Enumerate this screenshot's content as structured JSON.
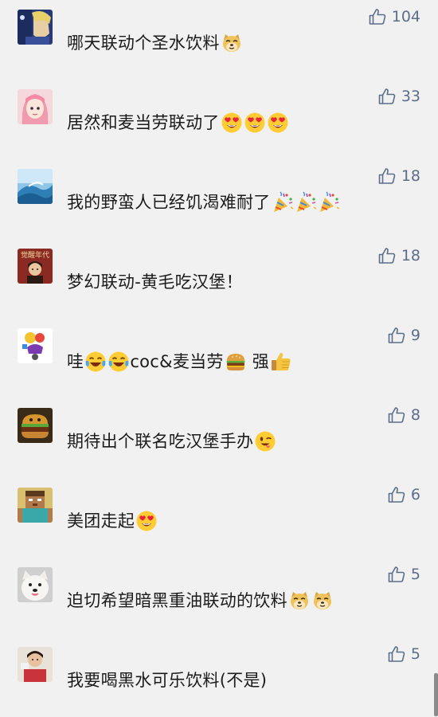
{
  "comments": [
    {
      "text": "哪天联动个圣水饮料",
      "likes": "104",
      "emojis": [
        "doge"
      ]
    },
    {
      "text": "居然和麦当劳联动了",
      "likes": "33",
      "emojis": [
        "heart-eyes",
        "heart-eyes",
        "heart-eyes"
      ]
    },
    {
      "text": "我的野蛮人已经饥渴难耐了",
      "likes": "18",
      "emojis": [
        "party",
        "party",
        "party"
      ]
    },
    {
      "text": "梦幻联动-黄毛吃汉堡！",
      "likes": "18",
      "emojis": []
    },
    {
      "text_parts": [
        "哇",
        "coc&麦当劳",
        " 强"
      ],
      "likes": "9"
    },
    {
      "text": "期待出个联名吃汉堡手办",
      "likes": "8",
      "emojis": [
        "wink"
      ]
    },
    {
      "text": "美团走起",
      "likes": "6",
      "emojis": [
        "heart-eyes"
      ]
    },
    {
      "text": "迫切希望暗黑重油联动的饮料",
      "likes": "5",
      "emojis": [
        "doge",
        "doge"
      ]
    },
    {
      "text": "我要喝黑水可乐饮料(不是)",
      "likes": "5",
      "emojis": []
    }
  ],
  "avatar_texts": {
    "c4": "觉醒年代"
  },
  "colors": {
    "background": "#f1f1f1",
    "text": "#1b1b1b",
    "like": "#5c6d8a"
  },
  "icons": {
    "like": "thumbs-up-outline-icon",
    "emojis": [
      "doge-emoji-icon",
      "heart-eyes-emoji-icon",
      "party-popper-emoji-icon",
      "crying-laughing-emoji-icon",
      "hamburger-emoji-icon",
      "thumbs-up-emoji-icon",
      "wink-emoji-icon"
    ]
  }
}
